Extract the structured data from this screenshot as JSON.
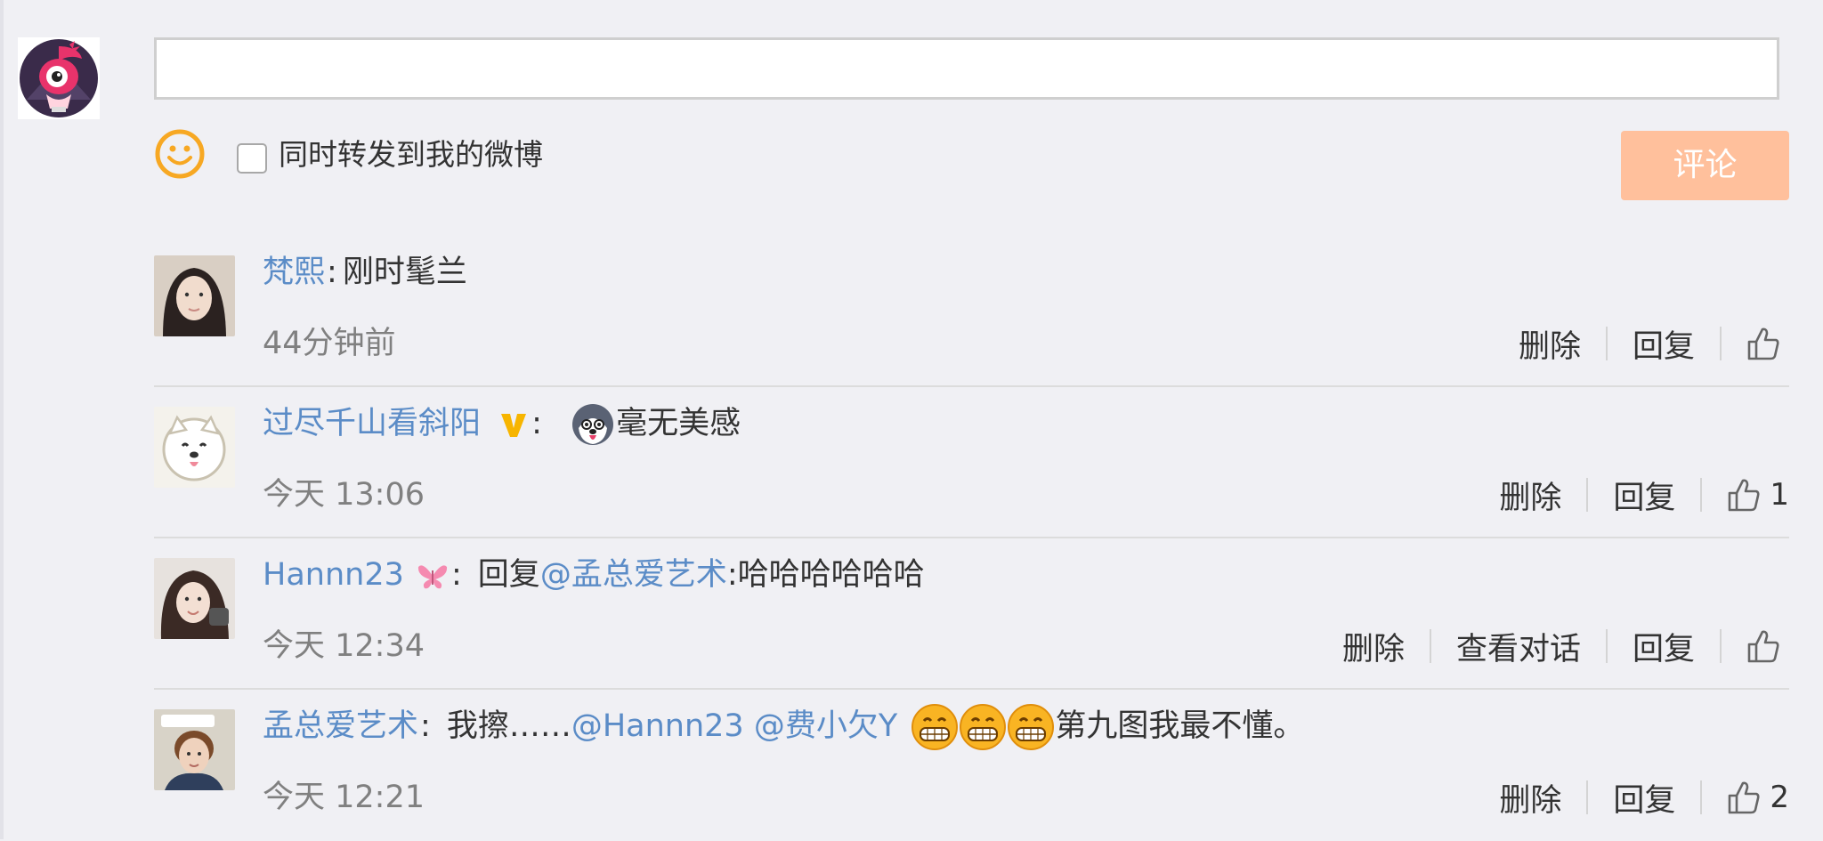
{
  "composer": {
    "input_value": "",
    "input_placeholder": "",
    "forward_label": "同时转发到我的微博",
    "submit_label": "评论",
    "submit_color": "#ffc09c"
  },
  "comments": [
    {
      "user": "梵熙",
      "segments": [
        {
          "type": "text",
          "text": "刚时髦兰"
        }
      ],
      "time": "44分钟前",
      "delete_label": "删除",
      "reply_label": "回复",
      "likes": ""
    },
    {
      "user": "过尽千山看斜阳",
      "verified_badge": "v-badge-icon",
      "segments": [
        {
          "type": "emoji",
          "name": "husky-emoji-icon"
        },
        {
          "type": "text",
          "text": "毫无美感"
        }
      ],
      "time": "今天 13:06",
      "delete_label": "删除",
      "reply_label": "回复",
      "likes": "1"
    },
    {
      "user": "Hannn23",
      "user_badge": "butterfly-badge-icon",
      "segments": [
        {
          "type": "text",
          "text": "回复"
        },
        {
          "type": "mention",
          "text": "@孟总爱艺术"
        },
        {
          "type": "text",
          "text": ":哈哈哈哈哈哈"
        }
      ],
      "time": "今天 12:34",
      "delete_label": "删除",
      "view_conversation_label": "查看对话",
      "reply_label": "回复",
      "likes": ""
    },
    {
      "user": "孟总爱艺术",
      "segments": [
        {
          "type": "text",
          "text": "我擦……"
        },
        {
          "type": "mention",
          "text": "@Hannn23"
        },
        {
          "type": "text",
          "text": " "
        },
        {
          "type": "mention",
          "text": "@费小欠Y"
        },
        {
          "type": "emoji",
          "name": "grin-emoji-icon"
        },
        {
          "type": "emoji",
          "name": "grin-emoji-icon"
        },
        {
          "type": "emoji",
          "name": "grin-emoji-icon"
        },
        {
          "type": "text",
          "text": "第九图我最不懂。"
        }
      ],
      "time": "今天 12:21",
      "delete_label": "删除",
      "reply_label": "回复",
      "likes": "2"
    }
  ],
  "colors": {
    "link": "#5b8cc7",
    "background": "#f0f0f4",
    "timestamp": "#808080",
    "emoji_face": "#f9b423"
  }
}
